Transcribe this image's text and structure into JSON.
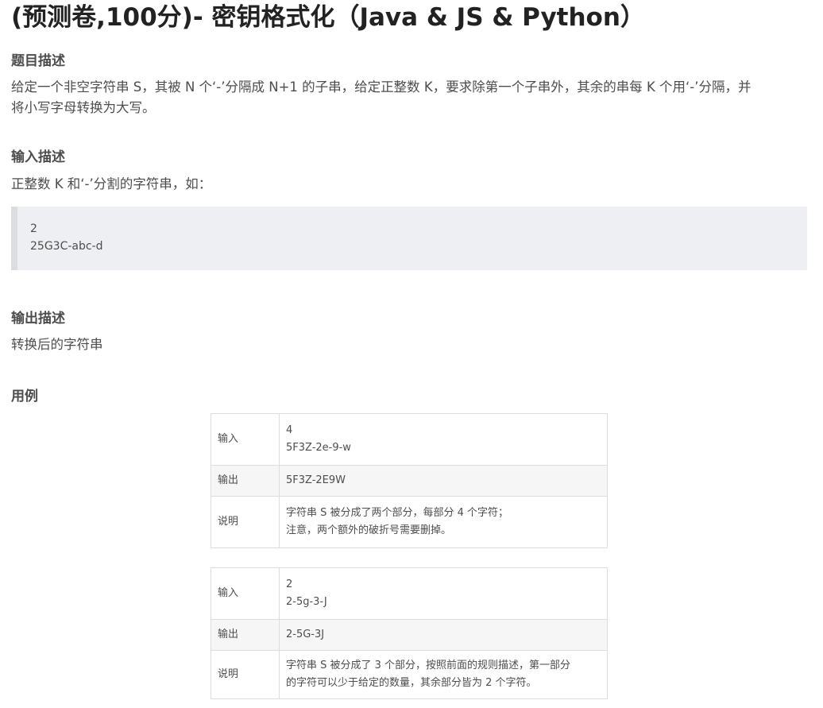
{
  "title": "(预测卷,100分)- 密钥格式化（Java & JS & Python）",
  "sections": {
    "problem": {
      "heading": "题目描述",
      "line1": "给定一个非空字符串 S，其被 N 个‘-’分隔成 N+1 的子串，给定正整数 K，要求除第一个子串外，其余的串每 K 个用‘-’分隔，并",
      "line2": "将小写字母转换为大写。"
    },
    "input": {
      "heading": "输入描述",
      "text": "正整数 K 和‘-’分割的字符串，如：",
      "code_lines": [
        "2",
        "25G3C-abc-d"
      ]
    },
    "output": {
      "heading": "输出描述",
      "text": "转换后的字符串"
    },
    "examples_heading": "用例"
  },
  "examples": [
    {
      "input_label": "输入",
      "input_lines": [
        "4",
        "5F3Z-2e-9-w"
      ],
      "output_label": "输出",
      "output": "5F3Z-2E9W",
      "note_label": "说明",
      "note_lines": [
        "字符串 S 被分成了两个部分，每部分 4 个字符；",
        "注意，两个额外的破折号需要删掉。"
      ]
    },
    {
      "input_label": "输入",
      "input_lines": [
        "2",
        "2-5g-3-J"
      ],
      "output_label": "输出",
      "output": "2-5G-3J",
      "note_label": "说明",
      "note_lines": [
        "字符串 S 被分成了 3 个部分，按照前面的规则描述，第一部分",
        "的字符可以少于给定的数量，其余部分皆为 2 个字符。"
      ]
    }
  ]
}
